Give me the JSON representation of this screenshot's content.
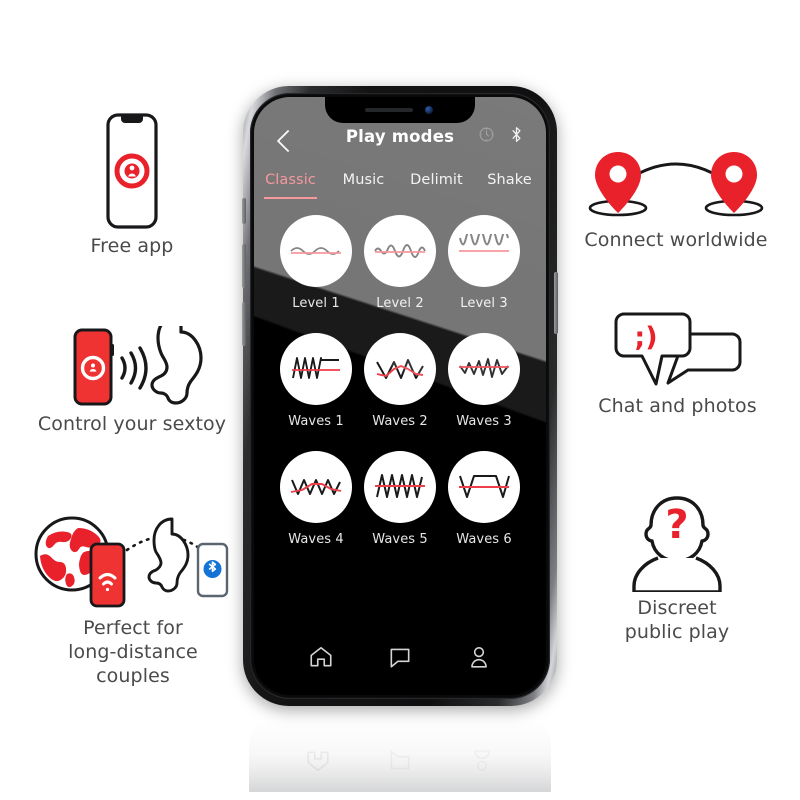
{
  "theme": {
    "brand_red": "#e8212b",
    "accent_red": "#ef3e49",
    "caption_color": "#4a4a4a",
    "screen_bg": "#000000"
  },
  "phone": {
    "app": {
      "header": {
        "back_icon": "chevron-left-icon",
        "title": "Play modes",
        "status_icons": [
          "timer-dial-icon",
          "bluetooth-icon"
        ]
      },
      "tabs": [
        {
          "label": "Classic",
          "active": true
        },
        {
          "label": "Music",
          "active": false
        },
        {
          "label": "Delimit",
          "active": false
        },
        {
          "label": "Shake",
          "active": false
        }
      ],
      "modes": [
        {
          "label": "Level 1",
          "icon": "wave-sine-low-icon"
        },
        {
          "label": "Level 2",
          "icon": "wave-sine-mid-icon"
        },
        {
          "label": "Level 3",
          "icon": "wave-sine-high-icon"
        },
        {
          "label": "Waves 1",
          "icon": "wave-zigzag-step-icon"
        },
        {
          "label": "Waves 2",
          "icon": "wave-peak-icon"
        },
        {
          "label": "Waves 3",
          "icon": "wave-mixed-icon"
        },
        {
          "label": "Waves 4",
          "icon": "wave-double-zigzag-icon"
        },
        {
          "label": "Waves 5",
          "icon": "wave-sawtooth-icon"
        },
        {
          "label": "Waves 6",
          "icon": "wave-square-icon"
        }
      ],
      "bottom_nav": [
        {
          "name": "home",
          "icon": "home-icon"
        },
        {
          "name": "chat",
          "icon": "chat-bubble-icon"
        },
        {
          "name": "profile",
          "icon": "person-icon"
        }
      ]
    }
  },
  "features": {
    "free_app": {
      "caption": "Free app",
      "icon": "phone-with-app-icon"
    },
    "control": {
      "caption": "Control your sextoy",
      "icon": "phone-signal-toy-icon"
    },
    "long_distance": {
      "caption": "Perfect for\nlong-distance\ncouples",
      "icon": "globe-phone-toy-bluetooth-icon"
    },
    "connect": {
      "caption": "Connect worldwide",
      "icon": "two-map-pins-arc-icon"
    },
    "chat": {
      "caption": "Chat and photos",
      "icon": "speech-bubbles-wink-icon",
      "emoticon": ";)"
    },
    "discreet": {
      "caption": "Discreet\npublic play",
      "icon": "anonymous-person-icon",
      "glyph": "?"
    }
  }
}
